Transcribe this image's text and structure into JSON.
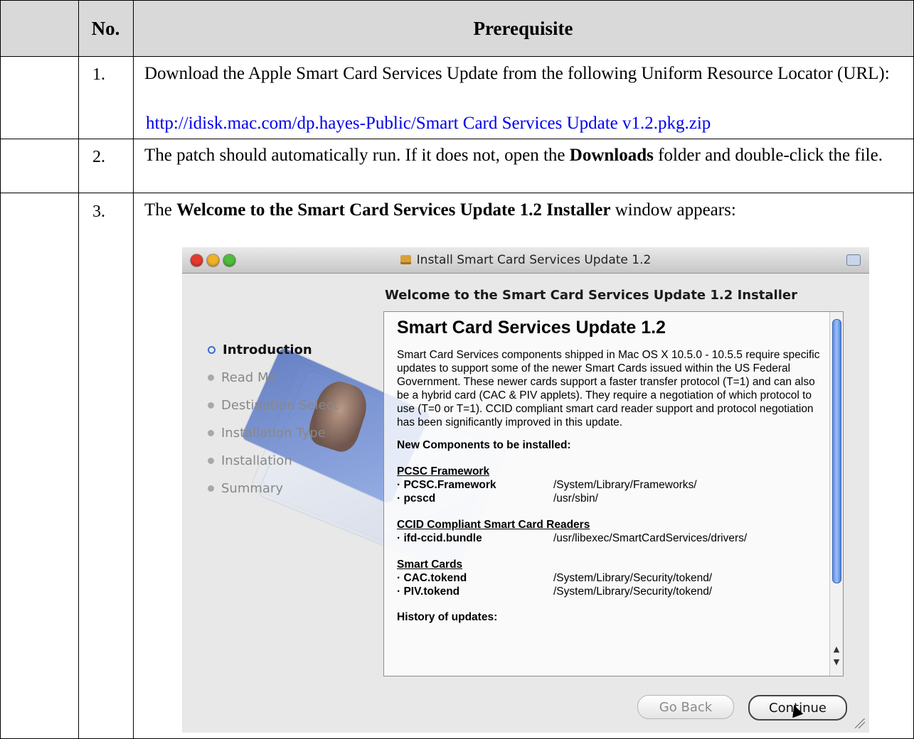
{
  "table": {
    "headers": {
      "col1": "",
      "no": "No.",
      "prerequisite": "Prerequisite"
    },
    "rows": [
      {
        "no": "1.",
        "text": "Download the Apple Smart Card Services Update from the following Uniform Resource Locator (URL):",
        "url": "http://idisk.mac.com/dp.hayes-Public/Smart Card Services Update v1.2.pkg.zip"
      },
      {
        "no": "2.",
        "text_pre": "The patch should automatically run.  If it does not, open the ",
        "text_bold": "Downloads",
        "text_post": " folder and double-click the file."
      },
      {
        "no": "3.",
        "text_pre": "The ",
        "text_bold": "Welcome to the Smart Card Services Update 1.2 Installer",
        "text_post": " window appears:"
      }
    ]
  },
  "installer": {
    "window_title": "Install Smart Card Services Update 1.2",
    "welcome_heading": "Welcome to the Smart Card Services Update 1.2 Installer",
    "steps": [
      "Introduction",
      "Read Me",
      "Destination Select",
      "Installation Type",
      "Installation",
      "Summary"
    ],
    "active_step": "Introduction",
    "content": {
      "title": "Smart Card Services Update 1.2",
      "body": "Smart Card Services components shipped in Mac OS X 10.5.0 - 10.5.5 require specific updates to support some of the newer Smart Cards issued within the US Federal Government.  These newer cards support a faster transfer protocol (T=1) and can also be a hybrid card (CAC & PIV applets).  They require a negotiation of which protocol to use (T=0 or T=1).  CCID compliant smart card reader support and protocol negotiation has been significantly improved in this update.",
      "components_heading": "New Components to be installed:",
      "groups": [
        {
          "heading": "PCSC Framework",
          "items": [
            {
              "name": "· PCSC.Framework",
              "path": "/System/Library/Frameworks/"
            },
            {
              "name": "· pcscd",
              "path": "/usr/sbin/"
            }
          ]
        },
        {
          "heading": "CCID Compliant Smart Card Readers",
          "items": [
            {
              "name": "· ifd-ccid.bundle",
              "path": "/usr/libexec/SmartCardServices/drivers/"
            }
          ]
        },
        {
          "heading": "Smart Cards",
          "items": [
            {
              "name": "· CAC.tokend",
              "path": "/System/Library/Security/tokend/"
            },
            {
              "name": "· PIV.tokend",
              "path": "/System/Library/Security/tokend/"
            }
          ]
        }
      ],
      "history_heading": "History of updates:"
    },
    "buttons": {
      "back": "Go Back",
      "continue": "Continue"
    },
    "colors": {
      "close": "#e6392f",
      "minimize": "#f1b128",
      "zoom": "#4dbd3a",
      "scroll_thumb": "#5b8ee8",
      "link": "#0000ee"
    },
    "icons": [
      "package-icon",
      "toolbar-toggle-icon",
      "mouse-cursor-icon",
      "resize-grip-icon"
    ]
  }
}
